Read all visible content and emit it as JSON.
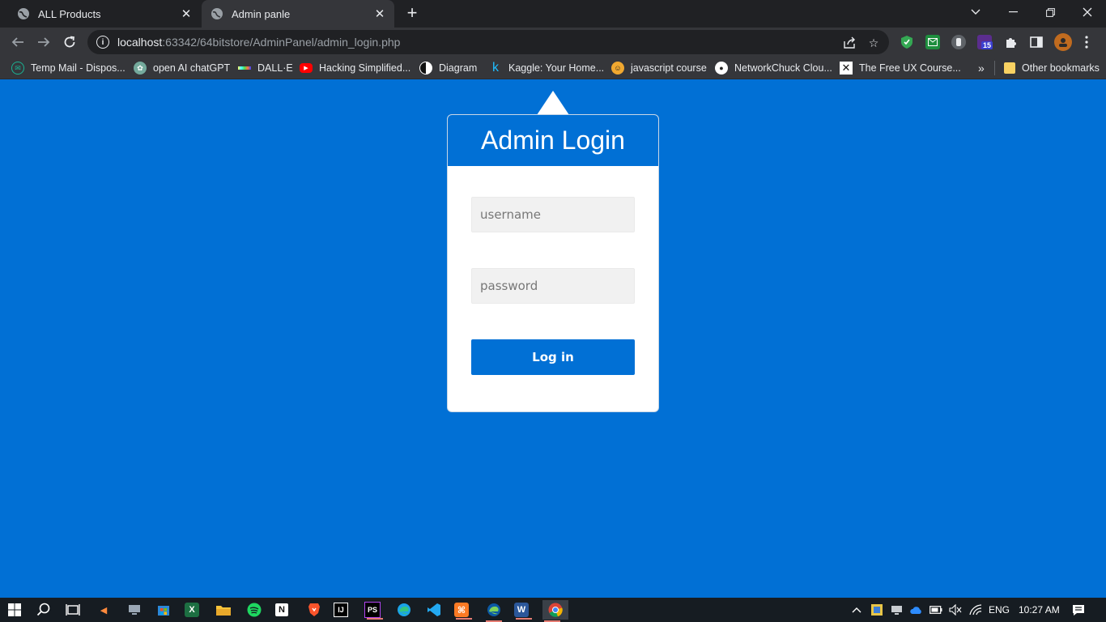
{
  "browser": {
    "tabs": [
      {
        "title": "ALL Products"
      },
      {
        "title": "Admin panle"
      }
    ],
    "url_host": "localhost",
    "url_rest": ":63342/64bitstore/AdminPanel/admin_login.php",
    "extension_badge": "15"
  },
  "bookmarks": [
    {
      "label": "Temp Mail - Dispos...",
      "color": "#1ab394"
    },
    {
      "label": "open AI chatGPT",
      "color": "#74aa9c"
    },
    {
      "label": "DALL·E",
      "color": "#ffcc00"
    },
    {
      "label": "Hacking Simplified...",
      "color": "#ff0000"
    },
    {
      "label": "Diagram",
      "color": "#ffffff"
    },
    {
      "label": "Kaggle: Your Home...",
      "color": "#20beff"
    },
    {
      "label": "javascript course",
      "color": "#f0a830"
    },
    {
      "label": "NetworkChuck Clou...",
      "color": "#ffffff"
    },
    {
      "label": "The Free UX Course...",
      "color": "#ffffff"
    },
    {
      "label": "Other bookmarks",
      "color": "#f9d262"
    }
  ],
  "login": {
    "title": "Admin Login",
    "username_placeholder": "username",
    "password_placeholder": "password",
    "button_label": "Log in"
  },
  "taskbar": {
    "language": "ENG",
    "time": "10:27 AM"
  },
  "colors": {
    "page_bg": "#0170d5",
    "card_bg": "#ffffff",
    "field_bg": "#f1f1f1"
  }
}
